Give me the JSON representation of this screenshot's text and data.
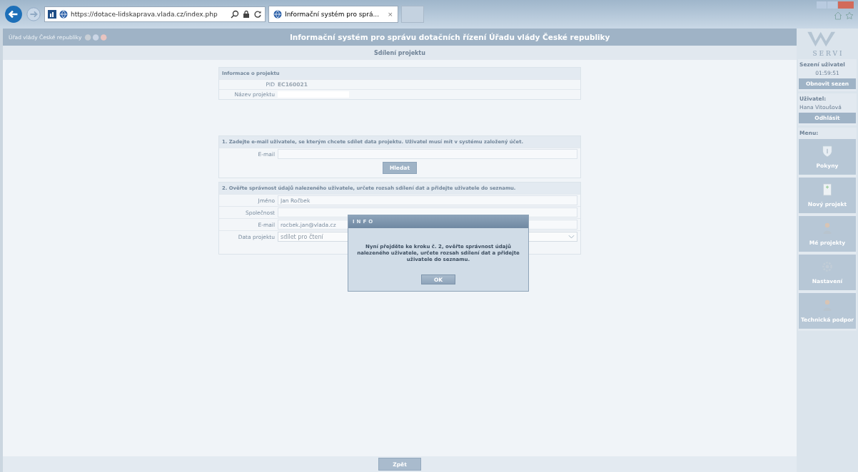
{
  "browser": {
    "url": "https://dotace-lidskaprava.vlada.cz/index.php",
    "tab": {
      "title": "Informační systém pro sprá...",
      "close": "×",
      "selected": true
    }
  },
  "header": {
    "org": "Úřad vlády České republiky",
    "title": "Informační systém pro správu dotačních řízení Úřadu vlády České republiky",
    "subtitle": "Sdílení projektu"
  },
  "info": {
    "heading": "Informace o projektu",
    "rows": [
      {
        "label": "PID",
        "value": "EC160021",
        "kind": "text"
      },
      {
        "label": "Název projektu",
        "kind": "redacted"
      }
    ]
  },
  "step1": {
    "heading": "1. Zadejte e-mail uživatele, se kterým chcete sdílet data projektu. Uživatel musí mít v systému založený účet.",
    "fields": [
      {
        "label": "E-mail",
        "kind": "input"
      }
    ],
    "button": "Hledat"
  },
  "step2": {
    "heading": "2. Ověřte správnost údajů nalezeného uživatele, určete rozsah sdílení dat a přidejte uživatele do seznamu.",
    "fields": [
      {
        "label": "Jméno",
        "value": "Jan Ročbek",
        "kind": "input"
      },
      {
        "label": "Společnost",
        "kind": "input"
      },
      {
        "label": "E-mail",
        "value": "rocbek.jan@vlada.cz",
        "kind": "input"
      },
      {
        "label": "Data projektu",
        "value": "sdílet pro čtení",
        "kind": "select"
      }
    ]
  },
  "dialog": {
    "title": "INFO",
    "message": "Nyní přejděte ke kroku č. 2, ověřte správnost údajů nalezeného uživatele, určete rozsah sdílení dat a přidejte uživatele do seznamu.",
    "button": "OK"
  },
  "sidebar": {
    "logo_text": "S E R V I",
    "session_label": "Sezení uživatel",
    "session_time": "01:59:51",
    "refresh": "Obnovit sezen",
    "user_label": "Uživatel:",
    "user_name": "Hana Vitoušová",
    "logout": "Odhlásit",
    "menu_label": "Menu:",
    "menu": [
      {
        "label": "Pokyny",
        "kind": "shield"
      },
      {
        "label": "Nový projekt",
        "kind": "doc"
      },
      {
        "label": "Mé projekty",
        "kind": "person"
      },
      {
        "label": "Nastavení",
        "kind": "gear"
      },
      {
        "label": "Technická podpor",
        "kind": "person"
      }
    ]
  },
  "footer": {
    "button": "Zpět"
  }
}
